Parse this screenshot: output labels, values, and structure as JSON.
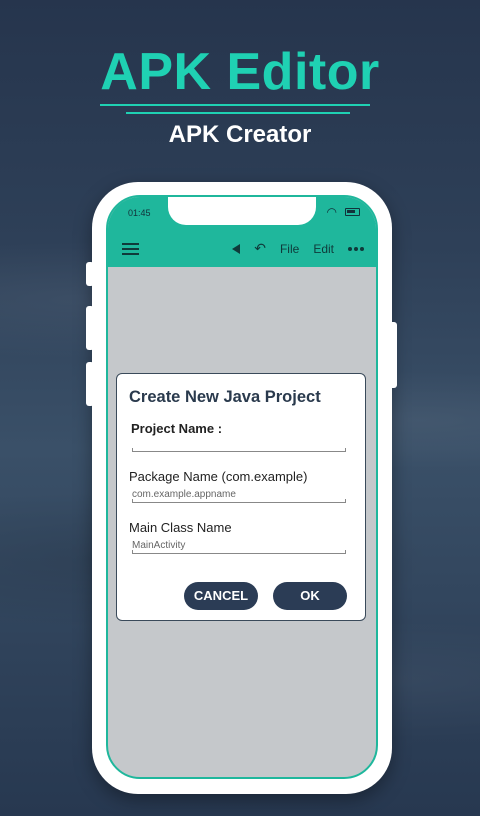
{
  "hero": {
    "title": "APK Editor",
    "subtitle": "APK Creator"
  },
  "colors": {
    "accent": "#1fd1b3",
    "appbar": "#1fb79c",
    "button": "#2b3c55"
  },
  "status_bar": {
    "time": "01:45",
    "icons": [
      "wifi-icon",
      "battery-icon"
    ]
  },
  "toolbar": {
    "icons": [
      "menu-icon",
      "play-icon",
      "undo-icon",
      "more-icon"
    ],
    "file_label": "File",
    "edit_label": "Edit"
  },
  "dialog": {
    "title": "Create New Java Project",
    "project_name_label": "Project Name :",
    "project_name_value": "",
    "package_name_label": "Package Name (com.example)",
    "package_name_value": "com.example.appname",
    "main_class_label": "Main Class Name",
    "main_class_value": "MainActivity",
    "cancel_label": "CANCEL",
    "ok_label": "OK"
  }
}
